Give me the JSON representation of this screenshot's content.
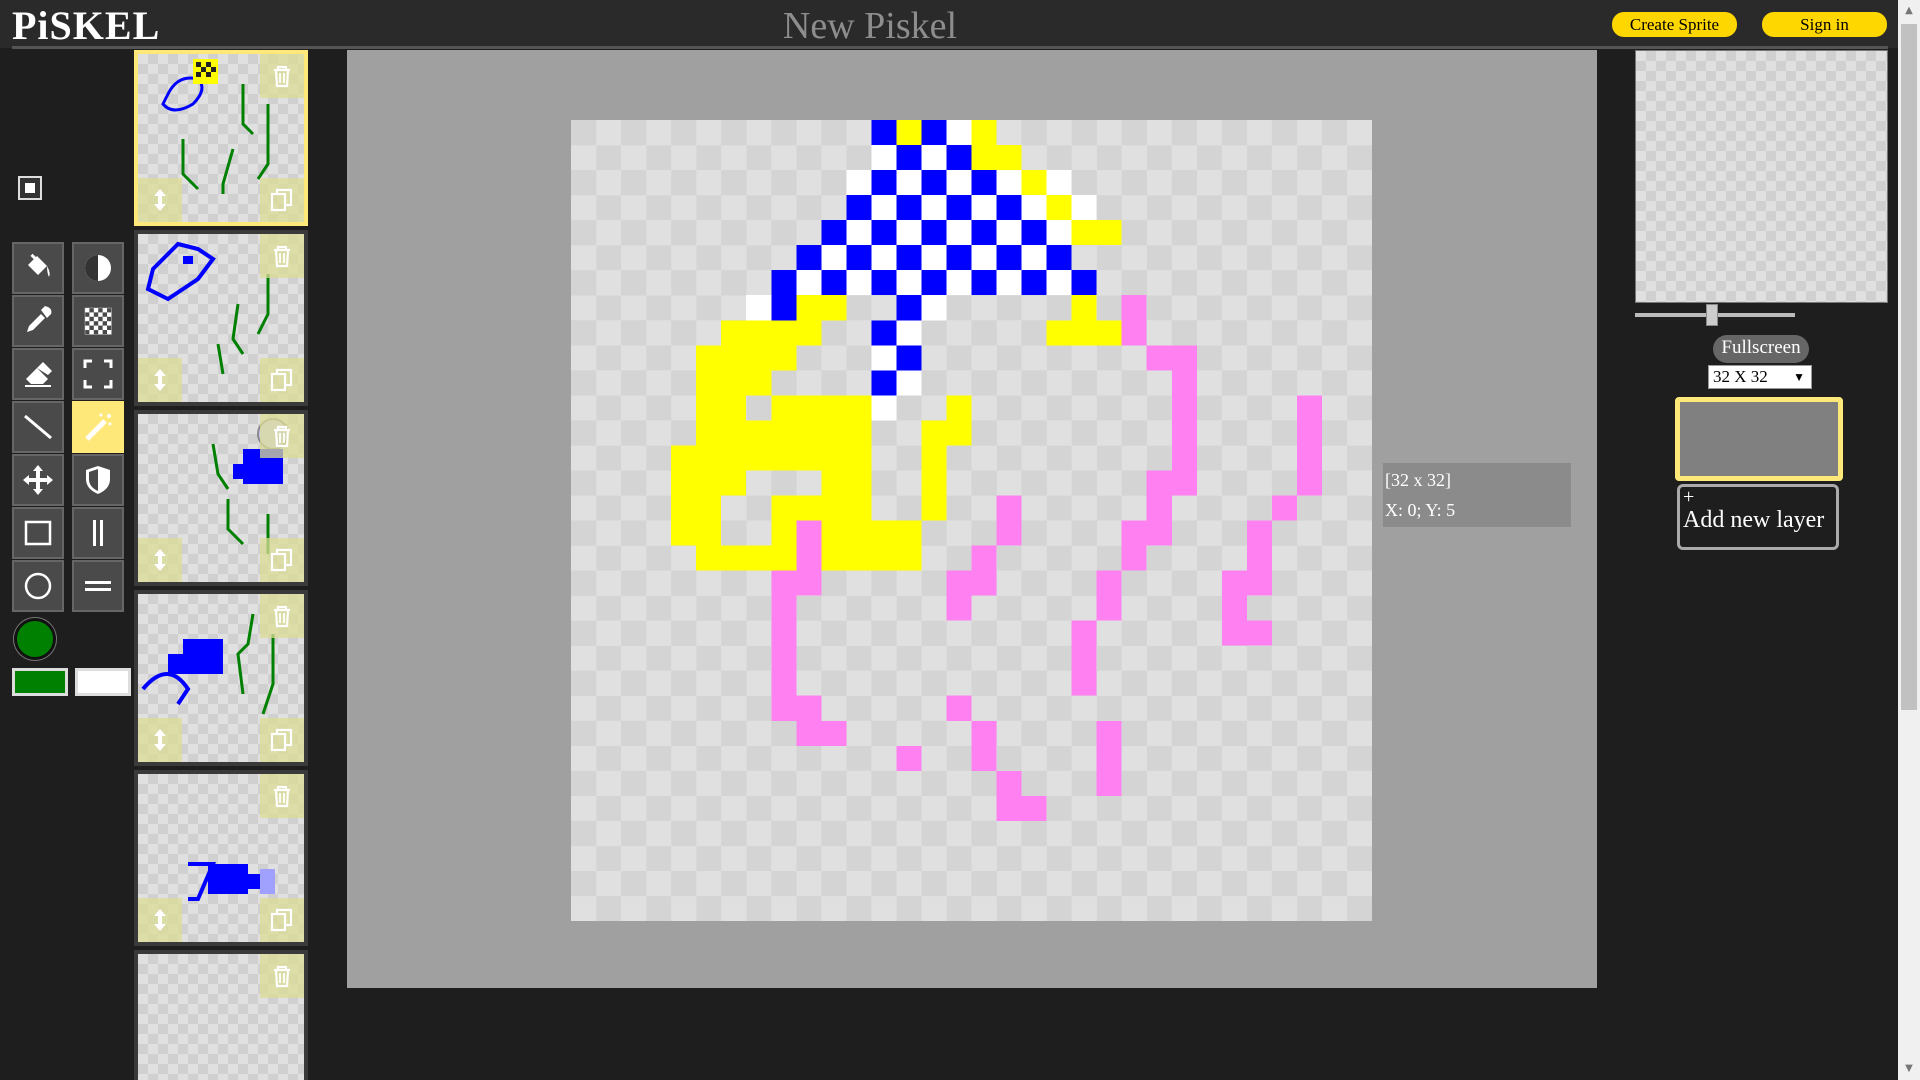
{
  "app": {
    "logo": "PiSKEL",
    "document_title": "New Piskel"
  },
  "header": {
    "create_sprite": "Create Sprite",
    "sign_in": "Sign in"
  },
  "tools": [
    {
      "name": "paint-bucket-icon"
    },
    {
      "name": "dither-icon"
    },
    {
      "name": "eyedropper-icon"
    },
    {
      "name": "checker-icon"
    },
    {
      "name": "eraser-icon"
    },
    {
      "name": "rectangle-select-icon"
    },
    {
      "name": "stroke-icon"
    },
    {
      "name": "magic-wand-icon",
      "active": true
    },
    {
      "name": "move-icon"
    },
    {
      "name": "shield-icon"
    },
    {
      "name": "rectangle-icon"
    },
    {
      "name": "vertical-mirror-icon"
    },
    {
      "name": "circle-icon"
    },
    {
      "name": "horizontal-mirror-icon"
    }
  ],
  "colors": {
    "primary": "#008000",
    "secondary": "#ffffff",
    "accent": "#ffd700",
    "selection": "#ffe87a"
  },
  "canvas": {
    "size_label": "[32 x 32]",
    "cursor_label": "X: 0; Y: 5"
  },
  "frames": {
    "count_visible": 6,
    "selected_index": 0
  },
  "right_panel": {
    "fullscreen": "Fullscreen",
    "size_option": "32 X 32",
    "add_layer_plus": "+",
    "add_layer": "Add new layer"
  }
}
